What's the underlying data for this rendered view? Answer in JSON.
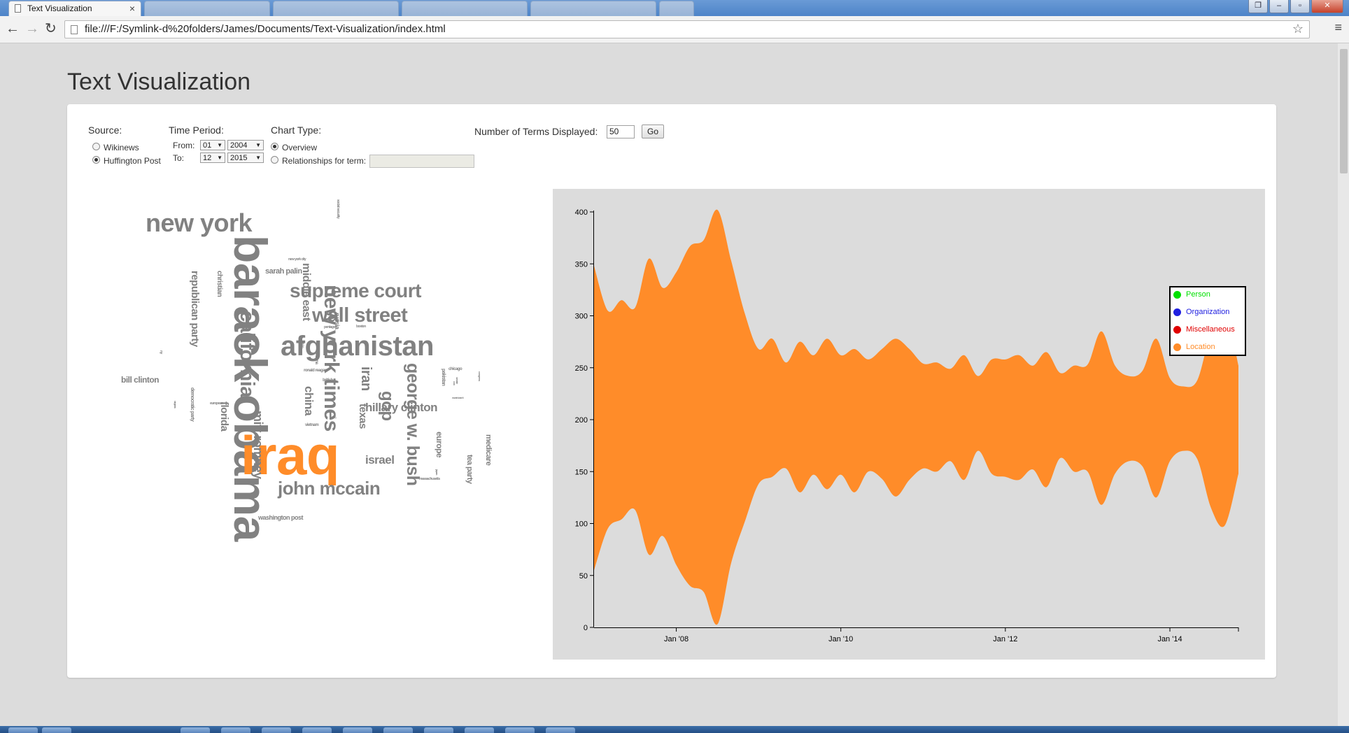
{
  "browser": {
    "tab_title": "Text Visualization",
    "tab_close": "×",
    "url": "file:///F:/Symlink-d%20folders/James/Documents/Text-Visualization/index.html",
    "back": "←",
    "forward": "→",
    "reload": "↻",
    "star": "☆",
    "menu": "≡",
    "window_controls": {
      "restore_down": "❐",
      "minimize": "–",
      "maximize": "▫",
      "close": "✕"
    }
  },
  "page": {
    "title": "Text Visualization"
  },
  "controls": {
    "source": {
      "label": "Source:",
      "options": [
        {
          "label": "Wikinews",
          "checked": false
        },
        {
          "label": "Huffington Post",
          "checked": true
        }
      ]
    },
    "time_period": {
      "label": "Time Period:",
      "from_label": "From:",
      "to_label": "To:",
      "from_month": "01",
      "from_year": "2004",
      "to_month": "12",
      "to_year": "2015",
      "arrow": "▼"
    },
    "chart_type": {
      "label": "Chart Type:",
      "options": [
        {
          "label": "Overview",
          "checked": true
        },
        {
          "label": "Relationships for term:",
          "checked": false
        }
      ],
      "term_value": ""
    },
    "terms": {
      "label": "Number of Terms Displayed:",
      "value": "50",
      "go_label": "Go"
    }
  },
  "word_cloud": {
    "words": [
      {
        "text": "new york"
      },
      {
        "text": "barack obama"
      },
      {
        "text": "iraq"
      },
      {
        "text": "afghanistan"
      },
      {
        "text": "supreme court"
      },
      {
        "text": "wall street"
      },
      {
        "text": "new york times"
      },
      {
        "text": "california"
      },
      {
        "text": "george w. bush"
      },
      {
        "text": "john mccain"
      },
      {
        "text": "hillary clinton"
      },
      {
        "text": "mitt romney"
      },
      {
        "text": "republican party"
      },
      {
        "text": "middle east"
      },
      {
        "text": "iran"
      },
      {
        "text": "gop"
      },
      {
        "text": "china"
      },
      {
        "text": "israel"
      },
      {
        "text": "texas"
      },
      {
        "text": "florida"
      },
      {
        "text": "bill clinton"
      },
      {
        "text": "sarah palin"
      },
      {
        "text": "europe"
      },
      {
        "text": "tea party"
      },
      {
        "text": "medicare"
      },
      {
        "text": "christian"
      },
      {
        "text": "washington post"
      },
      {
        "text": "russia"
      },
      {
        "text": "democratic party"
      },
      {
        "text": "pakistan"
      },
      {
        "text": "ronald reagan"
      },
      {
        "text": "chicago"
      },
      {
        "text": "british"
      },
      {
        "text": "ohio"
      },
      {
        "text": "vietnam"
      },
      {
        "text": "massachusetts"
      },
      {
        "text": "social security"
      },
      {
        "text": "new york city"
      },
      {
        "text": "pentagon"
      },
      {
        "text": "boston"
      },
      {
        "text": "arizona"
      },
      {
        "text": "european"
      },
      {
        "text": "world war ii"
      },
      {
        "text": "congress"
      },
      {
        "text": "d.c."
      },
      {
        "text": "virginia"
      },
      {
        "text": "senate"
      },
      {
        "text": "japan"
      },
      {
        "text": "ny"
      },
      {
        "text": "usa"
      }
    ]
  },
  "chart_data": {
    "type": "area",
    "subtype": "streamgraph",
    "x_ticks": [
      "Jan '08",
      "Jan '10",
      "Jan '12",
      "Jan '14"
    ],
    "ylim": [
      0,
      400
    ],
    "y_ticks": [
      0,
      50,
      100,
      150,
      200,
      250,
      300,
      350,
      400
    ],
    "legend_position": "top-right",
    "series": [
      {
        "name": "Person",
        "color": "#00e000"
      },
      {
        "name": "Organization",
        "color": "#2020e0"
      },
      {
        "name": "Miscellaneous",
        "color": "#e00000"
      },
      {
        "name": "Location",
        "color": "#ff8c29",
        "x": [
          "2007-01",
          "2007-03",
          "2007-05",
          "2007-07",
          "2007-09",
          "2007-11",
          "2008-01",
          "2008-03",
          "2008-05",
          "2008-07",
          "2008-09",
          "2008-11",
          "2009-01",
          "2009-03",
          "2009-05",
          "2009-07",
          "2009-09",
          "2009-11",
          "2010-01",
          "2010-03",
          "2010-05",
          "2010-07",
          "2010-09",
          "2010-11",
          "2011-01",
          "2011-03",
          "2011-05",
          "2011-07",
          "2011-09",
          "2011-11",
          "2012-01",
          "2012-03",
          "2012-05",
          "2012-07",
          "2012-09",
          "2012-11",
          "2013-01",
          "2013-03",
          "2013-05",
          "2013-07",
          "2013-09",
          "2013-11",
          "2014-01",
          "2014-03",
          "2014-05",
          "2014-07",
          "2014-09",
          "2014-11"
        ],
        "top": [
          348,
          305,
          315,
          308,
          355,
          327,
          342,
          367,
          373,
          402,
          353,
          302,
          268,
          278,
          255,
          275,
          262,
          278,
          262,
          268,
          258,
          268,
          278,
          268,
          254,
          255,
          249,
          262,
          242,
          258,
          258,
          262,
          252,
          265,
          245,
          252,
          253,
          285,
          252,
          242,
          247,
          278,
          240,
          232,
          238,
          285,
          307,
          252
        ],
        "bottom": [
          55,
          95,
          104,
          113,
          70,
          88,
          60,
          40,
          34,
          3,
          62,
          102,
          138,
          145,
          153,
          130,
          147,
          133,
          147,
          130,
          150,
          143,
          126,
          142,
          153,
          150,
          160,
          142,
          170,
          148,
          145,
          142,
          152,
          135,
          163,
          150,
          150,
          118,
          148,
          160,
          155,
          125,
          160,
          170,
          162,
          115,
          98,
          148
        ]
      }
    ]
  }
}
